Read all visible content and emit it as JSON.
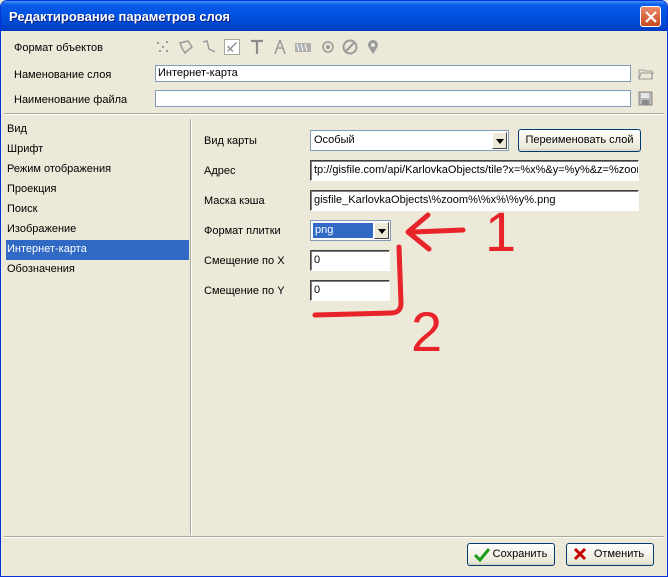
{
  "window": {
    "title": "Редактирование параметров слоя"
  },
  "layer": {
    "format_label": "Формат объектов",
    "name_label": "Наменование слоя",
    "name_value": "Интернет-карта",
    "file_label": "Наименование файла",
    "file_value": ""
  },
  "toolbar_icons": [
    "points-icon",
    "polygon-icon",
    "polyline-icon",
    "line-icon",
    "text-icon",
    "compass-icon",
    "pattern-icon",
    "circle-icon",
    "no-entry-icon",
    "marker-icon"
  ],
  "nav": {
    "items": [
      "Вид",
      "Шрифт",
      "Режим отображения",
      "Проекция",
      "Поиск",
      "Изображение",
      "Интернет-карта",
      "Обозначения"
    ],
    "selected": "Интернет-карта"
  },
  "form": {
    "map_type_label": "Вид карты",
    "map_type_value": "Особый",
    "rename_button": "Переименовать слой",
    "address_label": "Адрес",
    "address_value": "tp://gisfile.com/api/KarlovkaObjects/tile?x=%x%&y=%y%&z=%zoom%",
    "cache_label": "Маска кэша",
    "cache_value": "gisfile_KarlovkaObjects\\%zoom%\\%x%\\%y%.png",
    "tile_format_label": "Формат плитки",
    "tile_format_value": "png",
    "offset_x_label": "Смещение по X",
    "offset_x_value": "0",
    "offset_y_label": "Смещение по Y",
    "offset_y_value": "0"
  },
  "annotations": {
    "label_1": "1",
    "label_2": "2",
    "color": "#e8232a"
  },
  "buttons": {
    "save": "Сохранить",
    "cancel": "Отменить"
  },
  "colors": {
    "selection": "#316ac5",
    "title_bar": "#0054e3",
    "save_check": "#1a9e1a",
    "cancel_x": "#c40000"
  }
}
